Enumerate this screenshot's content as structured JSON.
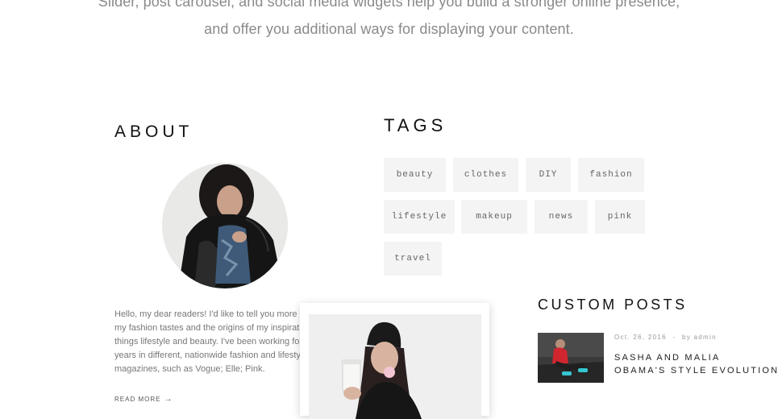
{
  "intro": {
    "line1": "Slider, post carousel, and social media widgets help you build a stronger online presence,",
    "line2": "and offer you additional ways for displaying your content."
  },
  "about": {
    "heading": "ABOUT",
    "lines": [
      "Hello, my dear readers! I'd like to tell you more about",
      "my fashion tastes and the origins of my inspiration:",
      "things lifestyle and beauty. I've been working for almost",
      "years in different, nationwide fashion and lifestyle",
      "magazines, such as Vogue; Elle; Pink."
    ],
    "read_more": "READ MORE"
  },
  "tags": {
    "heading": "TAGS",
    "items": [
      "beauty",
      "clothes",
      "DIY",
      "fashion",
      "lifestyle",
      "makeup",
      "news",
      "pink",
      "travel"
    ]
  },
  "custom_posts": {
    "heading": "CUSTOM POSTS",
    "post": {
      "date": "Oct. 26, 2016",
      "separator": "-",
      "author": "by admin",
      "title_line1": "SASHA AND MALIA",
      "title_line2": "OBAMA'S STYLE EVOLUTION"
    }
  }
}
